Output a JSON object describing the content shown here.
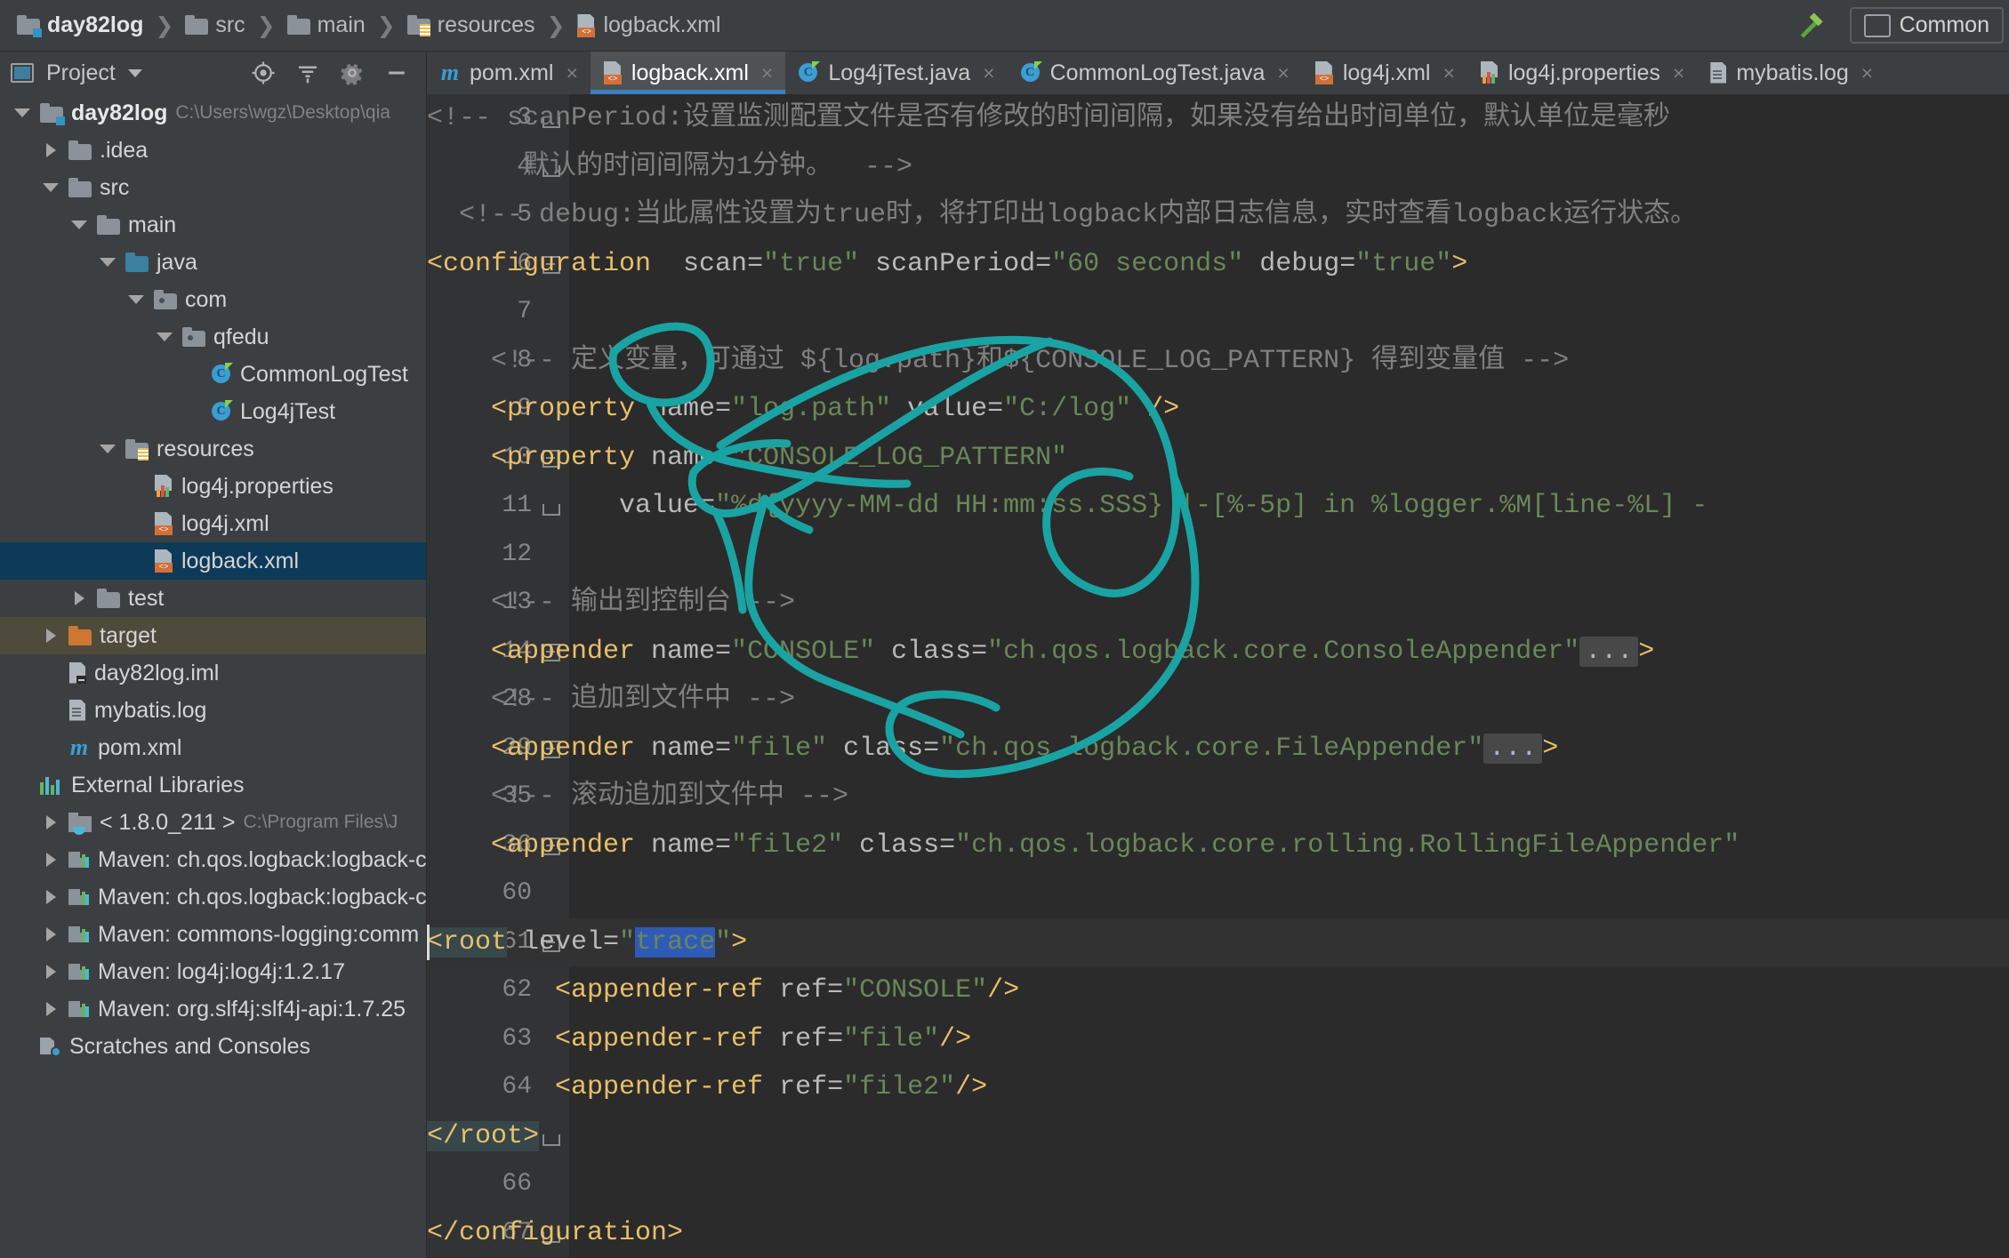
{
  "breadcrumb": {
    "items": [
      {
        "label": "day82log",
        "icon": "folder-module-icon"
      },
      {
        "label": "src",
        "icon": "folder-icon"
      },
      {
        "label": "main",
        "icon": "folder-icon"
      },
      {
        "label": "resources",
        "icon": "folder-resources-icon"
      },
      {
        "label": "logback.xml",
        "icon": "xml-file-icon"
      }
    ],
    "separator": "❯"
  },
  "topRight": {
    "hammer_icon": "hammer-icon",
    "run_config_label": "Common"
  },
  "projectPanel": {
    "title": "Project",
    "dropdown_icon": "chevron-down-icon",
    "header_icons": [
      "locate-icon",
      "collapse-all-icon",
      "settings-gear-icon",
      "minimize-icon"
    ],
    "tree": [
      {
        "label": "day82log",
        "path": "C:\\Users\\wgz\\Desktop\\qia",
        "indent": 0,
        "arrow": "down",
        "icon": "folder-module-icon",
        "bold": true,
        "state": "normal"
      },
      {
        "label": ".idea",
        "path": "",
        "indent": 1,
        "arrow": "right",
        "icon": "folder-icon",
        "bold": false,
        "state": "normal"
      },
      {
        "label": "src",
        "path": "",
        "indent": 1,
        "arrow": "down",
        "icon": "folder-icon",
        "bold": false,
        "state": "normal"
      },
      {
        "label": "main",
        "path": "",
        "indent": 2,
        "arrow": "down",
        "icon": "folder-icon",
        "bold": false,
        "state": "normal"
      },
      {
        "label": "java",
        "path": "",
        "indent": 3,
        "arrow": "down",
        "icon": "folder-source-icon",
        "bold": false,
        "state": "normal"
      },
      {
        "label": "com",
        "path": "",
        "indent": 4,
        "arrow": "down",
        "icon": "folder-package-icon",
        "bold": false,
        "state": "normal"
      },
      {
        "label": "qfedu",
        "path": "",
        "indent": 5,
        "arrow": "down",
        "icon": "folder-package-icon",
        "bold": false,
        "state": "normal"
      },
      {
        "label": "CommonLogTest",
        "path": "",
        "indent": 6,
        "arrow": "none",
        "icon": "java-class-icon",
        "bold": false,
        "state": "normal"
      },
      {
        "label": "Log4jTest",
        "path": "",
        "indent": 6,
        "arrow": "none",
        "icon": "java-class-icon",
        "bold": false,
        "state": "normal"
      },
      {
        "label": "resources",
        "path": "",
        "indent": 3,
        "arrow": "down",
        "icon": "folder-resources-icon",
        "bold": false,
        "state": "normal"
      },
      {
        "label": "log4j.properties",
        "path": "",
        "indent": 4,
        "arrow": "none",
        "icon": "properties-file-icon",
        "bold": false,
        "state": "normal"
      },
      {
        "label": "log4j.xml",
        "path": "",
        "indent": 4,
        "arrow": "none",
        "icon": "xml-file-icon",
        "bold": false,
        "state": "normal"
      },
      {
        "label": "logback.xml",
        "path": "",
        "indent": 4,
        "arrow": "none",
        "icon": "xml-file-icon",
        "bold": false,
        "state": "selected"
      },
      {
        "label": "test",
        "path": "",
        "indent": 2,
        "arrow": "right",
        "icon": "folder-icon",
        "bold": false,
        "state": "normal"
      },
      {
        "label": "target",
        "path": "",
        "indent": 1,
        "arrow": "right",
        "icon": "folder-target-icon",
        "bold": false,
        "state": "hovered"
      },
      {
        "label": "day82log.iml",
        "path": "",
        "indent": 1,
        "arrow": "none",
        "icon": "iml-file-icon",
        "bold": false,
        "state": "normal"
      },
      {
        "label": "mybatis.log",
        "path": "",
        "indent": 1,
        "arrow": "none",
        "icon": "log-file-icon",
        "bold": false,
        "state": "normal"
      },
      {
        "label": "pom.xml",
        "path": "",
        "indent": 1,
        "arrow": "none",
        "icon": "maven-pom-icon",
        "bold": false,
        "state": "normal"
      },
      {
        "label": "External Libraries",
        "path": "",
        "indent": 0,
        "arrow": "none",
        "icon": "external-libraries-icon",
        "bold": false,
        "state": "normal"
      },
      {
        "label": "< 1.8.0_211 >",
        "path": "C:\\Program Files\\J",
        "indent": 1,
        "arrow": "right",
        "icon": "jdk-icon",
        "bold": false,
        "state": "normal"
      },
      {
        "label": "Maven: ch.qos.logback:logback-cl",
        "path": "",
        "indent": 1,
        "arrow": "right",
        "icon": "jar-icon",
        "bold": false,
        "state": "normal"
      },
      {
        "label": "Maven: ch.qos.logback:logback-co",
        "path": "",
        "indent": 1,
        "arrow": "right",
        "icon": "jar-icon",
        "bold": false,
        "state": "normal"
      },
      {
        "label": "Maven: commons-logging:comm",
        "path": "",
        "indent": 1,
        "arrow": "right",
        "icon": "jar-icon",
        "bold": false,
        "state": "normal"
      },
      {
        "label": "Maven: log4j:log4j:1.2.17",
        "path": "",
        "indent": 1,
        "arrow": "right",
        "icon": "jar-icon",
        "bold": false,
        "state": "normal"
      },
      {
        "label": "Maven: org.slf4j:slf4j-api:1.7.25",
        "path": "",
        "indent": 1,
        "arrow": "right",
        "icon": "jar-icon",
        "bold": false,
        "state": "normal"
      },
      {
        "label": "Scratches and Consoles",
        "path": "",
        "indent": 0,
        "arrow": "none",
        "icon": "scratches-icon",
        "bold": false,
        "state": "normal"
      }
    ]
  },
  "editor": {
    "tabs": [
      {
        "label": "pom.xml",
        "icon": "maven-pom-icon",
        "active": false,
        "close": "×"
      },
      {
        "label": "logback.xml",
        "icon": "xml-file-icon",
        "active": true,
        "close": "×"
      },
      {
        "label": "Log4jTest.java",
        "icon": "java-class-icon",
        "active": false,
        "close": "×"
      },
      {
        "label": "CommonLogTest.java",
        "icon": "java-class-icon",
        "active": false,
        "close": "×"
      },
      {
        "label": "log4j.xml",
        "icon": "xml-file-icon",
        "active": false,
        "close": "×"
      },
      {
        "label": "log4j.properties",
        "icon": "properties-file-icon",
        "active": false,
        "close": "×"
      },
      {
        "label": "mybatis.log",
        "icon": "log-file-icon",
        "active": false,
        "close": "×"
      }
    ],
    "file_language": "XML",
    "selected_text": "trace",
    "lines": [
      {
        "num": "3",
        "fold": "cap-top",
        "indent": 0,
        "spans": [
          {
            "t": "<!-- scanPeriod:设置监测配置文件是否有修改的时间间隔，如果没有给出时间单位，默认单位是毫秒",
            "c": "cmt"
          }
        ]
      },
      {
        "num": "4",
        "fold": "cap-bottom",
        "indent": 0,
        "spans": [
          {
            "t": "      默认的时间间隔为1分钟。  -->",
            "c": "cmt"
          }
        ]
      },
      {
        "num": "5",
        "fold": "none",
        "indent": 0,
        "spans": [
          {
            "t": "  <!-- debug:当此属性设置为true时，将打印出logback内部日志信息，实时查看logback运行状态。",
            "c": "cmt"
          }
        ]
      },
      {
        "num": "6",
        "fold": "minus",
        "indent": 0,
        "spans": [
          {
            "t": "<configuration",
            "c": "tag"
          },
          {
            "t": "  scan=",
            "c": "attr"
          },
          {
            "t": "\"true\"",
            "c": "val"
          },
          {
            "t": " scanPeriod=",
            "c": "attr"
          },
          {
            "t": "\"60 seconds\"",
            "c": "val"
          },
          {
            "t": " debug=",
            "c": "attr"
          },
          {
            "t": "\"true\"",
            "c": "val"
          },
          {
            "t": ">",
            "c": "tag"
          }
        ]
      },
      {
        "num": "7",
        "fold": "none",
        "indent": 0,
        "spans": []
      },
      {
        "num": "8",
        "fold": "none",
        "indent": 0,
        "spans": [
          {
            "t": "    <!-- 定义变量，可通过 ${log.path}和${CONSOLE_LOG_PATTERN} 得到变量值 -->",
            "c": "cmt"
          }
        ]
      },
      {
        "num": "9",
        "fold": "none",
        "indent": 0,
        "spans": [
          {
            "t": "    <property",
            "c": "tag"
          },
          {
            "t": " name=",
            "c": "attr"
          },
          {
            "t": "\"log.path\"",
            "c": "val"
          },
          {
            "t": " value=",
            "c": "attr"
          },
          {
            "t": "\"C:/log\"",
            "c": "val"
          },
          {
            "t": " />",
            "c": "tag"
          }
        ]
      },
      {
        "num": "10",
        "fold": "minus",
        "indent": 0,
        "spans": [
          {
            "t": "    <property",
            "c": "tag"
          },
          {
            "t": " name=",
            "c": "attr"
          },
          {
            "t": "\"CONSOLE_LOG_PATTERN\"",
            "c": "val"
          }
        ]
      },
      {
        "num": "11",
        "fold": "cap-bottom",
        "indent": 0,
        "spans": [
          {
            "t": "            value=",
            "c": "attr"
          },
          {
            "t": "\"%d{yyyy-MM-dd HH:mm:ss.SSS} |-[%-5p] in %logger.%M[line-%L] -",
            "c": "val"
          }
        ]
      },
      {
        "num": "12",
        "fold": "none",
        "indent": 0,
        "spans": []
      },
      {
        "num": "13",
        "fold": "none",
        "indent": 0,
        "spans": [
          {
            "t": "    <!-- 输出到控制台 -->",
            "c": "cmt"
          }
        ]
      },
      {
        "num": "14",
        "fold": "plus",
        "indent": 0,
        "spans": [
          {
            "t": "    <appender",
            "c": "tag"
          },
          {
            "t": " name=",
            "c": "attr"
          },
          {
            "t": "\"CONSOLE\"",
            "c": "val"
          },
          {
            "t": " class=",
            "c": "attr"
          },
          {
            "t": "\"ch.qos.logback.core.ConsoleAppender\"",
            "c": "val"
          },
          {
            "t": "...",
            "c": "ellip"
          },
          {
            "t": ">",
            "c": "tag"
          }
        ]
      },
      {
        "num": "28",
        "fold": "none",
        "indent": 0,
        "spans": [
          {
            "t": "    <!-- 追加到文件中 -->",
            "c": "cmt"
          }
        ]
      },
      {
        "num": "29",
        "fold": "plus",
        "indent": 0,
        "spans": [
          {
            "t": "    <appender",
            "c": "tag"
          },
          {
            "t": " name=",
            "c": "attr"
          },
          {
            "t": "\"file\"",
            "c": "val"
          },
          {
            "t": " class=",
            "c": "attr"
          },
          {
            "t": "\"ch.qos.logback.core.FileAppender\"",
            "c": "val"
          },
          {
            "t": "...",
            "c": "ellip"
          },
          {
            "t": ">",
            "c": "tag"
          }
        ]
      },
      {
        "num": "35",
        "fold": "none",
        "indent": 0,
        "spans": [
          {
            "t": "    <!-- 滚动追加到文件中 -->",
            "c": "cmt"
          }
        ]
      },
      {
        "num": "36",
        "fold": "plus",
        "indent": 0,
        "spans": [
          {
            "t": "    <appender",
            "c": "tag"
          },
          {
            "t": " name=",
            "c": "attr"
          },
          {
            "t": "\"file2\"",
            "c": "val"
          },
          {
            "t": " class=",
            "c": "attr"
          },
          {
            "t": "\"ch.qos.logback.core.rolling.RollingFileAppender\"",
            "c": "val"
          }
        ]
      },
      {
        "num": "60",
        "fold": "none",
        "indent": 0,
        "spans": []
      },
      {
        "num": "61",
        "fold": "minus",
        "indent": 0,
        "highlight": true,
        "spans": [
          {
            "t": "<root",
            "c": "tag-sel"
          },
          {
            "t": " level=",
            "c": "attr"
          },
          {
            "t": "\"",
            "c": "val"
          },
          {
            "t": "trace",
            "c": "val-sel"
          },
          {
            "t": "\"",
            "c": "val"
          },
          {
            "t": ">",
            "c": "tag"
          }
        ]
      },
      {
        "num": "62",
        "fold": "none",
        "indent": 0,
        "spans": [
          {
            "t": "        <appender-ref",
            "c": "tag"
          },
          {
            "t": " ref=",
            "c": "attr"
          },
          {
            "t": "\"CONSOLE\"",
            "c": "val"
          },
          {
            "t": "/>",
            "c": "tag"
          }
        ]
      },
      {
        "num": "63",
        "fold": "none",
        "indent": 0,
        "spans": [
          {
            "t": "        <appender-ref",
            "c": "tag"
          },
          {
            "t": " ref=",
            "c": "attr"
          },
          {
            "t": "\"file\"",
            "c": "val"
          },
          {
            "t": "/>",
            "c": "tag"
          }
        ]
      },
      {
        "num": "64",
        "fold": "none",
        "indent": 0,
        "spans": [
          {
            "t": "        <appender-ref",
            "c": "tag"
          },
          {
            "t": " ref=",
            "c": "attr"
          },
          {
            "t": "\"file2\"",
            "c": "val"
          },
          {
            "t": "/>",
            "c": "tag"
          }
        ]
      },
      {
        "num": "65",
        "fold": "cap-bottom",
        "indent": 0,
        "spans": [
          {
            "t": "</root>",
            "c": "tag-sel"
          }
        ]
      },
      {
        "num": "66",
        "fold": "none",
        "indent": 0,
        "spans": []
      },
      {
        "num": "67",
        "fold": "cap-bottom",
        "indent": 0,
        "spans": [
          {
            "t": "</configuration>",
            "c": "tag"
          }
        ]
      }
    ]
  },
  "annotation": {
    "type": "freehand-ink",
    "color": "#1aa3a3",
    "description": "hand-drawn teal scribble circling the root level trace value and the appender-ref lines"
  },
  "colors": {
    "editor_bg": "#2b2b2b",
    "panel_bg": "#3c3f41",
    "gutter_bg": "#313335",
    "accent_blue": "#3d7fbf",
    "selection_blue": "#2f5bb7",
    "tree_selected": "#0d3a58",
    "tree_hover": "#4e4a3c",
    "tag": "#e8bf6a",
    "value": "#6a8759",
    "comment": "#808080",
    "attr": "#bababa",
    "ink": "#1aa3a3"
  }
}
